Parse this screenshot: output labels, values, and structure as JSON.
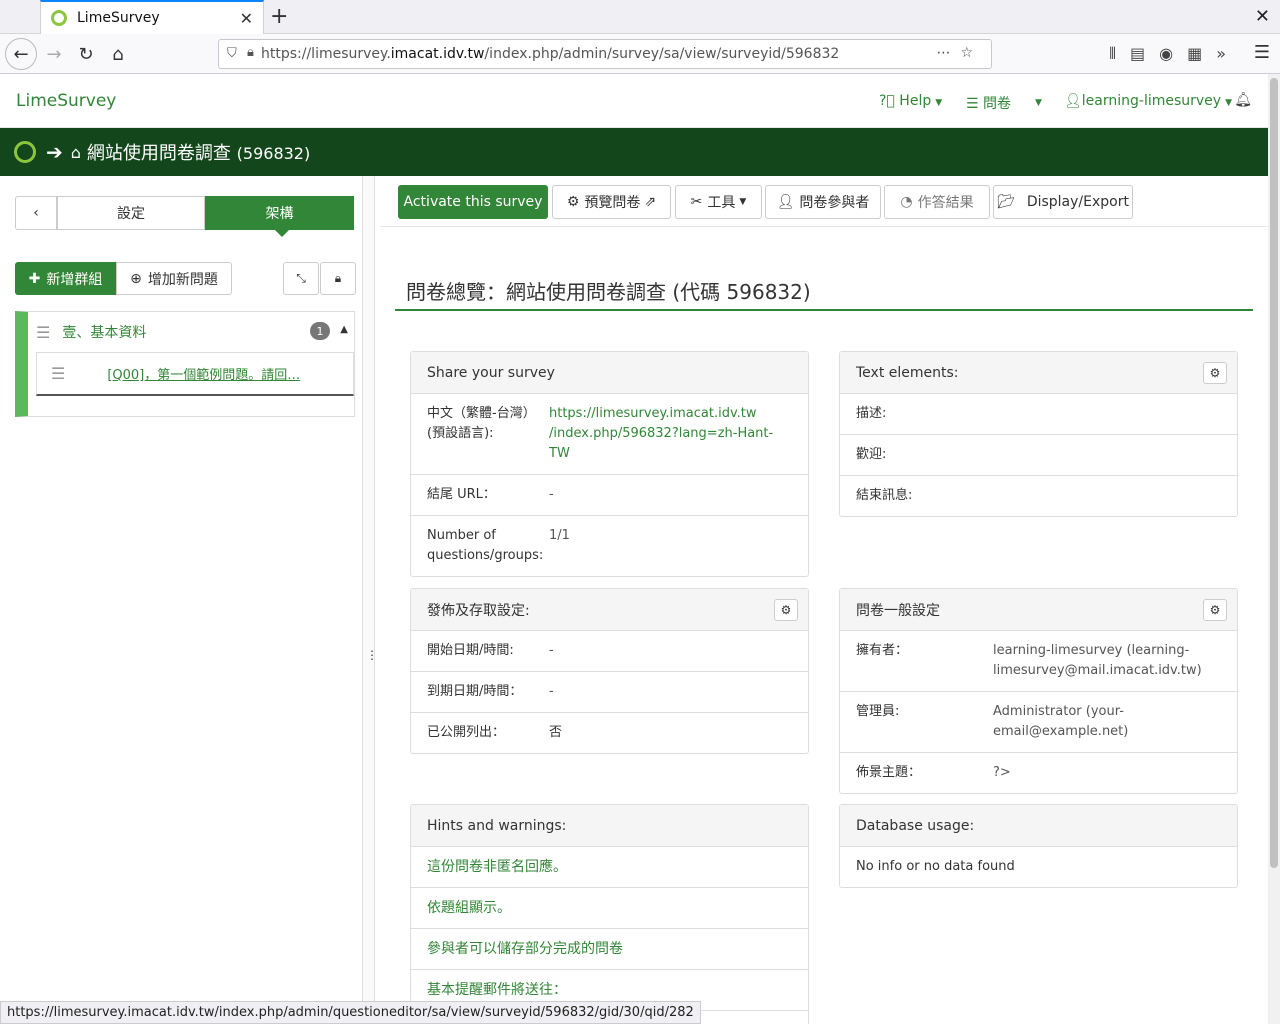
{
  "browser": {
    "tab_title": "LimeSurvey",
    "url_prefix": "https://limesurvey.",
    "url_domain": "imacat.idv.tw",
    "url_path": "/index.php/admin/survey/sa/view/surveyid/596832",
    "status_url": "https://limesurvey.imacat.idv.tw/index.php/admin/questioneditor/sa/view/surveyid/596832/gid/30/qid/282"
  },
  "header": {
    "brand": "LimeSurvey",
    "help": "Help",
    "surveys": "問卷",
    "user": "learning-limesurvey"
  },
  "titlebar": {
    "title": "網站使用問卷調查",
    "id": "(596832)"
  },
  "sidebar": {
    "tab_settings": "設定",
    "tab_structure": "架構",
    "add_group": "新增群組",
    "add_question": "增加新問題",
    "group_name": "壹、基本資料",
    "group_count": "1",
    "question_label": "[Q00]，第一個範例問題。請回…"
  },
  "toolbar": {
    "activate": "Activate this survey",
    "preview": "預覽問卷",
    "tools": "工具",
    "participants": "問卷參與者",
    "responses": "作答結果",
    "display_export": "Display/Export"
  },
  "main": {
    "heading": "問卷總覽：網站使用問卷調查 (代碼 596832)"
  },
  "share": {
    "title": "Share your survey",
    "lang_label": "中文（繁體-台灣）(預設語言):",
    "link_line1": "https://limesurvey.imacat.idv.tw",
    "link_line2": "/index.php/596832?lang=zh-Hant-TW",
    "end_url_label": "結尾 URL：",
    "end_url_value": "-",
    "count_label": "Number of questions/groups:",
    "count_value": "1/1"
  },
  "text_elements": {
    "title": "Text elements:",
    "description": "描述:",
    "welcome": "歡迎:",
    "end_message": "結束訊息:"
  },
  "publish": {
    "title": "發佈及存取設定:",
    "start_label": "開始日期/時間:",
    "start_value": "-",
    "expiry_label": "到期日期/時間：",
    "expiry_value": "-",
    "public_label": "已公開列出：",
    "public_value": "否"
  },
  "general": {
    "title": "問卷一般設定",
    "owner_label": "擁有者：",
    "owner_value": "learning-limesurvey (learning-limesurvey@mail.imacat.idv.tw)",
    "admin_label": "管理員:",
    "admin_value": "Administrator (your-email@example.net)",
    "theme_label": "佈景主題：",
    "theme_value": "?>"
  },
  "hints": {
    "title": "Hints and warnings:",
    "items": [
      "這份問卷非匿名回應。",
      "依題組顯示。",
      "參與者可以儲存部分完成的問卷",
      "基本提醒郵件將送往："
    ]
  },
  "database": {
    "title": "Database usage:",
    "value": "No info or no data found"
  }
}
